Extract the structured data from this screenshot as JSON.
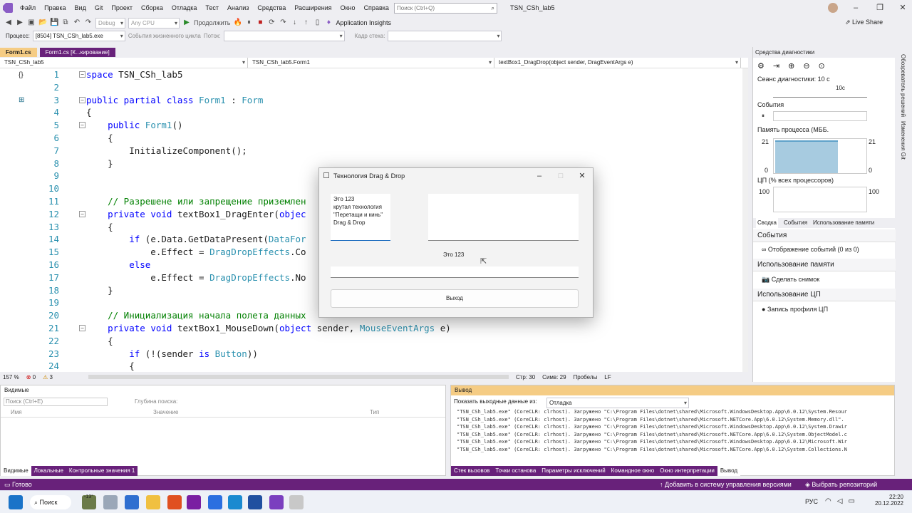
{
  "menu": [
    "Файл",
    "Правка",
    "Вид",
    "Git",
    "Проект",
    "Сборка",
    "Отладка",
    "Тест",
    "Анализ",
    "Средства",
    "Расширения",
    "Окно",
    "Справка"
  ],
  "search_placeholder": "Поиск (Ctrl+Q)",
  "solution_title": "TSN_CSh_lab5",
  "toolbar": {
    "config": "Debug",
    "platform": "Any CPU",
    "continue_label": "Продолжить",
    "app_insights": "Application Insights",
    "live_share": "Live Share"
  },
  "toolbar2": {
    "process_label": "Процесс:",
    "process_value": "[8504] TSN_CSh_lab5.exe",
    "lifecycle_label": "События жизненного цикла",
    "thread_label": "Поток:",
    "stack_label": "Кадр стека:"
  },
  "doc_tabs": [
    "Form1.cs",
    "Form1.cs [К...кирование]"
  ],
  "nav": [
    "TSN_CSh_lab5",
    "TSN_CSh_lab5.Form1",
    "textBox1_DragDrop(object sender, DragEventArgs e)"
  ],
  "code_lines": [
    {
      "n": "1",
      "html": "<span class='kw'>space</span> TSN_CSh_lab5"
    },
    {
      "n": "2",
      "html": ""
    },
    {
      "n": "3",
      "html": "<span class='kw'>public partial class</span> <span class='ty'>Form1</span> : <span class='ty'>Form</span>"
    },
    {
      "n": "4",
      "html": "{"
    },
    {
      "n": "5",
      "html": "    <span class='kw'>public</span> <span class='ty'>Form1</span>()"
    },
    {
      "n": "6",
      "html": "    {"
    },
    {
      "n": "7",
      "html": "        InitializeComponent();"
    },
    {
      "n": "8",
      "html": "    }"
    },
    {
      "n": "9",
      "html": ""
    },
    {
      "n": "10",
      "html": ""
    },
    {
      "n": "11",
      "html": "    <span class='cm'>// Разрешене или запрещение приземлен</span>"
    },
    {
      "n": "12",
      "html": "    <span class='kw'>private void</span> textBox1_DragEnter(<span class='kw'>objec</span>"
    },
    {
      "n": "13",
      "html": "    {"
    },
    {
      "n": "14",
      "html": "        <span class='kw'>if</span> (e.Data.GetDataPresent(<span class='ty'>DataFor</span>"
    },
    {
      "n": "15",
      "html": "            e.Effect = <span class='ty'>DragDropEffects</span>.Co"
    },
    {
      "n": "16",
      "html": "        <span class='kw'>else</span>"
    },
    {
      "n": "17",
      "html": "            e.Effect = <span class='ty'>DragDropEffects</span>.No"
    },
    {
      "n": "18",
      "html": "    }"
    },
    {
      "n": "19",
      "html": ""
    },
    {
      "n": "20",
      "html": "    <span class='cm'>// Инициализация начала полета данных</span>"
    },
    {
      "n": "21",
      "html": "    <span class='kw'>private void</span> textBox1_MouseDown(<span class='kw'>object</span> sender, <span class='ty'>MouseEventArgs</span> e)"
    },
    {
      "n": "22",
      "html": "    {"
    },
    {
      "n": "23",
      "html": "        <span class='kw'>if</span> (!(sender <span class='kw'>is</span> <span class='ty'>Button</span>))"
    },
    {
      "n": "24",
      "html": "        {"
    }
  ],
  "editor_status": {
    "zoom": "157 %",
    "errors": "0",
    "warnings": "3",
    "line": "Стр: 30",
    "col": "Симв: 29",
    "ws": "Пробелы",
    "eol": "LF"
  },
  "diag": {
    "title": "Средства диагностики",
    "session": "Сеанс диагностики: 10 с",
    "tick": "10с",
    "events": "События",
    "memory": "Память процесса (МБ",
    "mem_max": "21",
    "mem_min": "0",
    "cpu": "ЦП (% всех процессоров)",
    "cpu_max": "100",
    "tabs": [
      "Сводка",
      "События",
      "Использование памяти"
    ],
    "sec_events": "События",
    "show_events": "Отображение событий (0 из 0)",
    "sec_mem": "Использование памяти",
    "snapshot": "Сделать снимок",
    "sec_cpu": "Использование ЦП",
    "cpu_profile": "Запись профиля ЦП"
  },
  "side_tabs": [
    "Обозреватель решений",
    "Изменения Git"
  ],
  "locals": {
    "title": "Видимые",
    "search": "Поиск (Ctrl+E)",
    "depth": "Глубина поиска:",
    "cols": [
      "Имя",
      "Значение",
      "Тип"
    ],
    "tabs": [
      "Видимые",
      "Локальные",
      "Контрольные значения 1"
    ]
  },
  "output": {
    "title": "Вывод",
    "show_label": "Показать выходные данные из:",
    "show_value": "Отладка",
    "lines": [
      "\"TSN_CSh_lab5.exe\" (CoreCLR: clrhost). Загружено \"C:\\Program Files\\dotnet\\shared\\Microsoft.WindowsDesktop.App\\6.0.12\\System.Resour",
      "\"TSN_CSh_lab5.exe\" (CoreCLR: clrhost). Загружено \"C:\\Program Files\\dotnet\\shared\\Microsoft.NETCore.App\\6.0.12\\System.Memory.dll\".",
      "\"TSN_CSh_lab5.exe\" (CoreCLR: clrhost). Загружено \"C:\\Program Files\\dotnet\\shared\\Microsoft.WindowsDesktop.App\\6.0.12\\System.Drawir",
      "\"TSN_CSh_lab5.exe\" (CoreCLR: clrhost). Загружено \"C:\\Program Files\\dotnet\\shared\\Microsoft.NETCore.App\\6.0.12\\System.ObjectModel.c",
      "\"TSN_CSh_lab5.exe\" (CoreCLR: clrhost). Загружено \"C:\\Program Files\\dotnet\\shared\\Microsoft.WindowsDesktop.App\\6.0.12\\Microsoft.Wir",
      "\"TSN_CSh_lab5.exe\" (CoreCLR: clrhost). Загружено \"C:\\Program Files\\dotnet\\shared\\Microsoft.NETCore.App\\6.0.12\\System.Collections.N"
    ],
    "tabs": [
      "Стек вызовов",
      "Точки останова",
      "Параметры исключений",
      "Командное окно",
      "Окно интерпретации",
      "Вывод"
    ]
  },
  "status": {
    "ready": "Готово",
    "vcs": "Добавить в систему управления версиями",
    "repo": "Выбрать репозиторий"
  },
  "taskbar": {
    "search": "Поиск",
    "weather": "-13°",
    "lang": "РУС",
    "time": "22:20",
    "date": "20.12.2022"
  },
  "dialog": {
    "title": "Технология Drag & Drop",
    "tb1_text": "Это 123\nкрутая технология\n\"Перетащи и кинь\"\nDrag & Drop",
    "label": "Это 123",
    "exit": "Выход"
  }
}
